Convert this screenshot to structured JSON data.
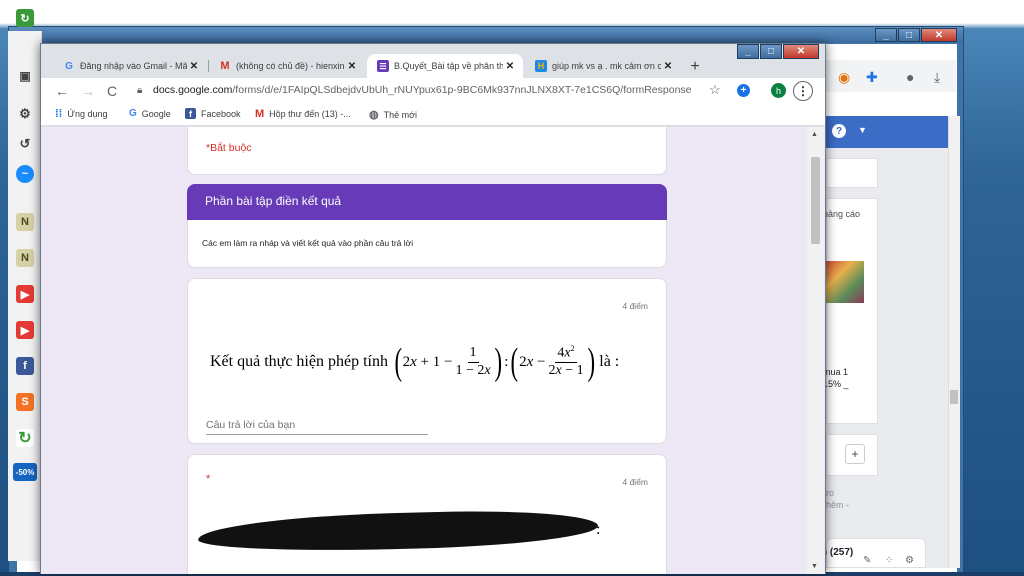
{
  "tabs": [
    {
      "title": "Đăng nhập vào Gmail - Mã",
      "favicon": "google-icon",
      "color": "#4285f4"
    },
    {
      "title": "(không có chủ đề) - hienxin",
      "favicon": "gmail-icon",
      "color": "#d93025"
    },
    {
      "title": "B.Quyết_Bài tập về phân th",
      "favicon": "forms-icon",
      "color": "#673ab7",
      "active": true
    },
    {
      "title": "giúp mk vs ạ . mk cảm ơn c",
      "favicon": "hoc24-icon",
      "color": "#f4b400"
    }
  ],
  "url": {
    "host": "docs.google.com",
    "path": "/forms/d/e/1FAIpQLSdbejdvUbUh_rNUYpux61p-9BC6Mk937nnJLNX8XT-7e1CS6Q/formResponse"
  },
  "profile_initial": "h",
  "bookmarks": [
    {
      "label": "Ứng dụng",
      "icon": "apps-icon"
    },
    {
      "label": "Google",
      "icon": "google-icon"
    },
    {
      "label": "Facebook",
      "icon": "facebook-icon"
    },
    {
      "label": "Hộp thư đến (13) -...",
      "icon": "gmail-icon"
    },
    {
      "label": "Thẻ mới",
      "icon": "globe-icon"
    }
  ],
  "form": {
    "required_note": "*Bắt buộc",
    "section_title": "Phần bài tập điền kết quả",
    "section_description": "Các em làm ra nháp và viết kết quả vào phần câu trả lời",
    "q1": {
      "points": "4 điểm",
      "prefix": "Kết  quả thực hiện phép tính",
      "suffix": "là :",
      "answer_placeholder": "Câu trả lời của bạn"
    },
    "q2": {
      "required_mark": "*",
      "points": "4 điểm"
    }
  },
  "back_window": {
    "ad_label": "uảng cáo",
    "promo_line1": "mua 1",
    "promo_line2": "15% _",
    "add_label": "+",
    "line_a": "ro",
    "line_b": "hêm -",
    "count_label": "n (257)",
    "sale_badge": "-50%"
  }
}
